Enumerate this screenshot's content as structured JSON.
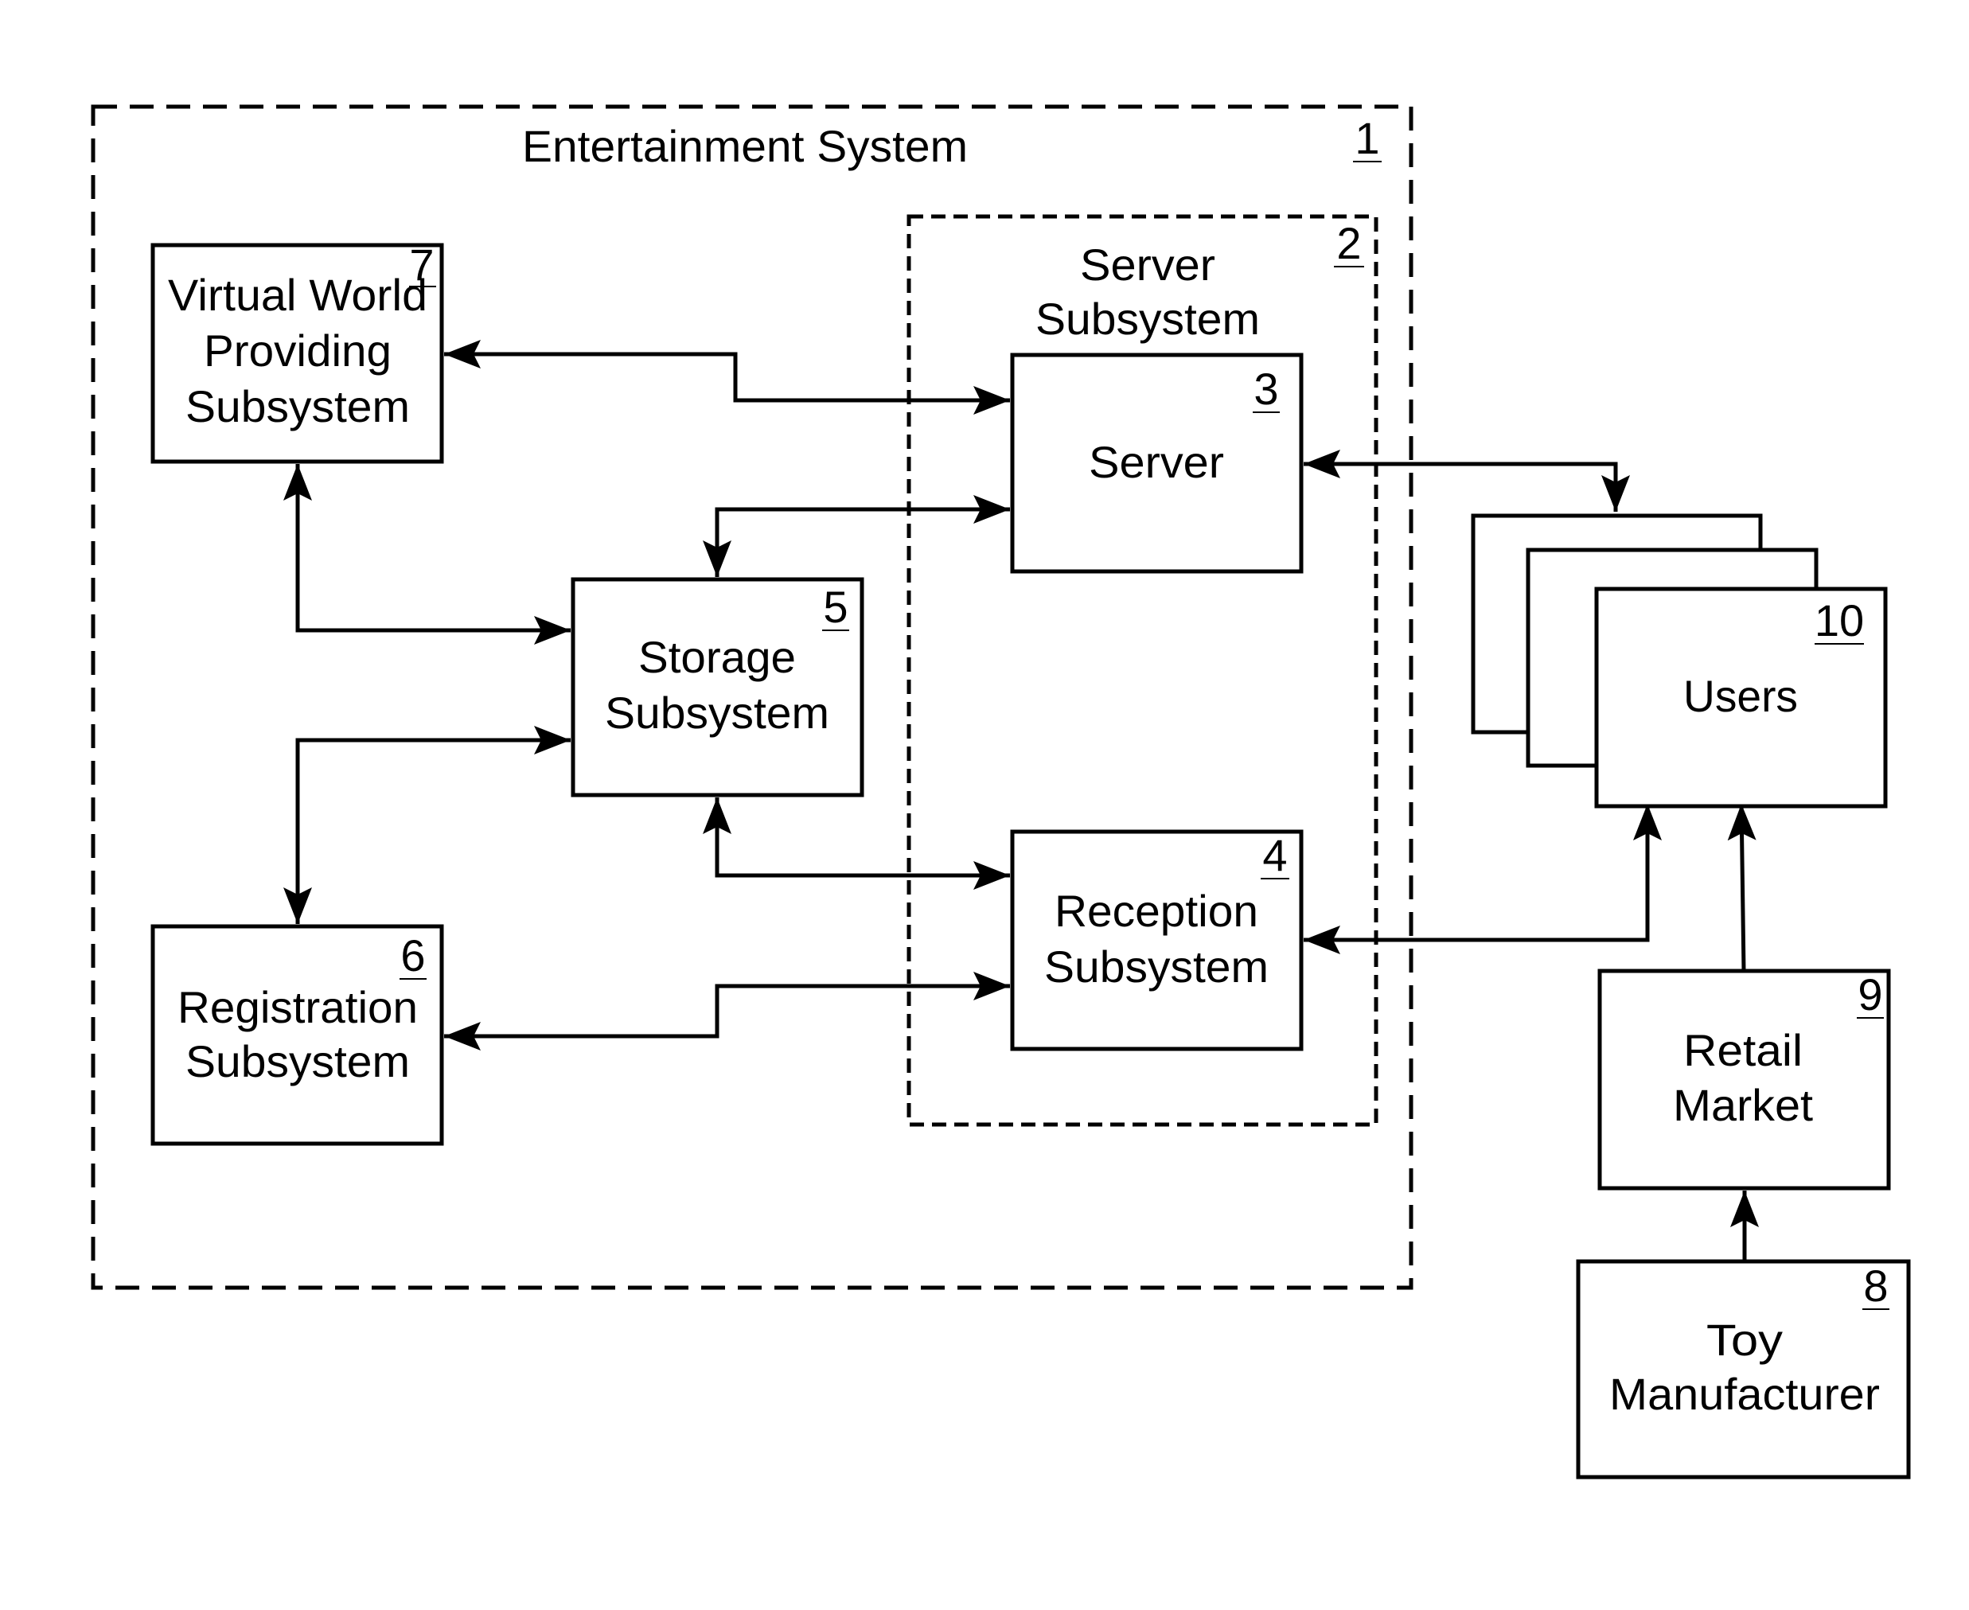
{
  "diagram": {
    "outer_container": {
      "id": "1",
      "title": "Entertainment System"
    },
    "server_subsystem": {
      "id": "2",
      "title_lines": [
        "Server",
        "Subsystem"
      ]
    },
    "nodes": {
      "server": {
        "id": "3",
        "lines": [
          "Server"
        ]
      },
      "reception": {
        "id": "4",
        "lines": [
          "Reception",
          "Subsystem"
        ]
      },
      "storage": {
        "id": "5",
        "lines": [
          "Storage",
          "Subsystem"
        ]
      },
      "registration": {
        "id": "6",
        "lines": [
          "Registration",
          "Subsystem"
        ]
      },
      "virtual_world": {
        "id": "7",
        "lines": [
          "Virtual World",
          "Providing",
          "Subsystem"
        ]
      },
      "toy_manufacturer": {
        "id": "8",
        "lines": [
          "Toy",
          "Manufacturer"
        ]
      },
      "retail_market": {
        "id": "9",
        "lines": [
          "Retail",
          "Market"
        ]
      },
      "users": {
        "id": "10",
        "lines": [
          "Users"
        ]
      }
    },
    "connections": [
      {
        "from": "virtual_world",
        "to": "server",
        "direction": "bidirectional"
      },
      {
        "from": "virtual_world",
        "to": "storage",
        "direction": "bidirectional"
      },
      {
        "from": "storage",
        "to": "server",
        "direction": "bidirectional"
      },
      {
        "from": "registration",
        "to": "storage",
        "direction": "bidirectional"
      },
      {
        "from": "storage",
        "to": "reception",
        "direction": "bidirectional"
      },
      {
        "from": "registration",
        "to": "reception",
        "direction": "bidirectional"
      },
      {
        "from": "server",
        "to": "users",
        "direction": "bidirectional"
      },
      {
        "from": "reception",
        "to": "users",
        "direction": "bidirectional"
      },
      {
        "from": "retail_market",
        "to": "users",
        "direction": "forward"
      },
      {
        "from": "toy_manufacturer",
        "to": "retail_market",
        "direction": "forward"
      }
    ]
  }
}
